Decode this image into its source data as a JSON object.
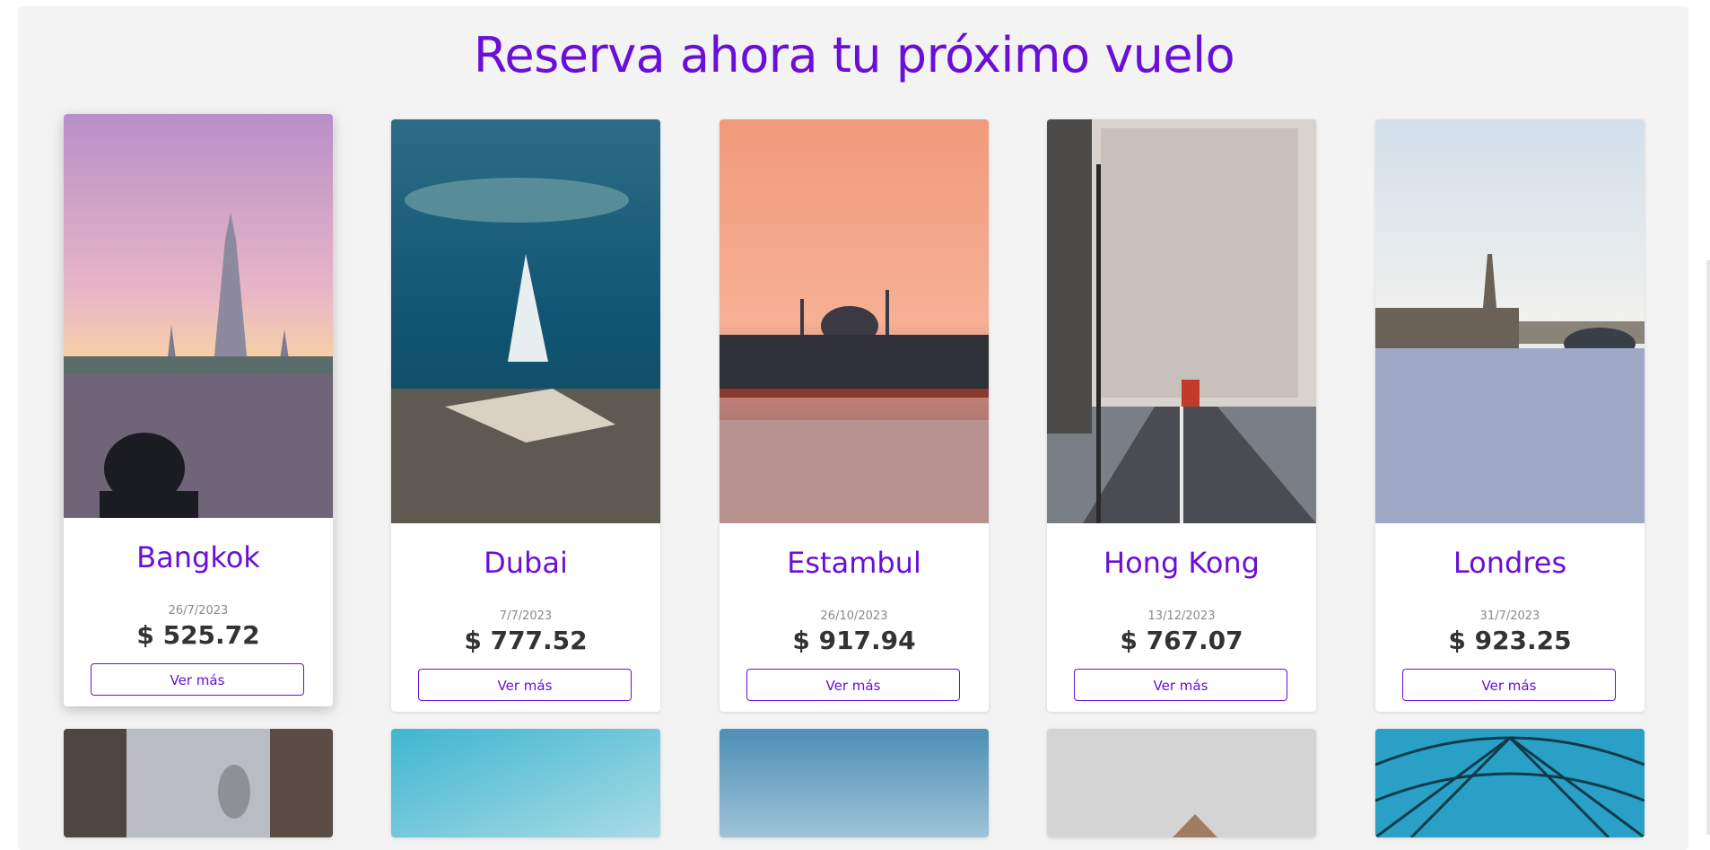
{
  "heading": "Reserva ahora tu próximo vuelo",
  "accent_color": "#6a0fd8",
  "cards": [
    {
      "city": "Bangkok",
      "date": "26/7/2023",
      "price": "$ 525.72",
      "button": "Ver más",
      "image": "temple-sunset-photographer"
    },
    {
      "city": "Dubai",
      "date": "7/7/2023",
      "price": "$ 777.52",
      "button": "Ver más",
      "image": "burj-al-arab-aerial"
    },
    {
      "city": "Estambul",
      "date": "26/10/2023",
      "price": "$ 917.94",
      "button": "Ver más",
      "image": "mosque-bridge-sunset"
    },
    {
      "city": "Hong Kong",
      "date": "13/12/2023",
      "price": "$ 767.07",
      "button": "Ver más",
      "image": "city-street-buildings"
    },
    {
      "city": "Londres",
      "date": "31/7/2023",
      "price": "$ 923.25",
      "button": "Ver más",
      "image": "big-ben-thames"
    }
  ],
  "second_row_images": [
    "narrow-street-dome",
    "sky-light-blue",
    "sky-clouds",
    "grey-sky-roof",
    "glass-dome-lattice"
  ]
}
